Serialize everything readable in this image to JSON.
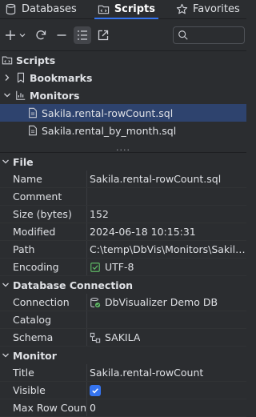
{
  "tabs": [
    {
      "label": "Databases",
      "icon": "database-icon"
    },
    {
      "label": "Scripts",
      "icon": "scripts-folder-icon"
    },
    {
      "label": "Favorites",
      "icon": "star-icon"
    }
  ],
  "search": {
    "placeholder": ""
  },
  "tree": {
    "scripts": "Scripts",
    "bookmarks": "Bookmarks",
    "monitors": "Monitors",
    "files": [
      "Sakila.rental-rowCount.sql",
      "Sakila.rental_by_month.sql"
    ]
  },
  "splitter": "....",
  "sections": {
    "file": "File",
    "db": "Database Connection",
    "monitor": "Monitor"
  },
  "file_props": {
    "name_label": "Name",
    "name": "Sakila.rental-rowCount.sql",
    "comment_label": "Comment",
    "comment": "",
    "size_label": "Size (bytes)",
    "size": "152",
    "modified_label": "Modified",
    "modified": "2024-06-18 10:15:31",
    "path_label": "Path",
    "path": "C:\\temp\\DbVis\\Monitors\\Sakila.rental-rowCount.sql",
    "encoding_label": "Encoding",
    "encoding": "UTF-8"
  },
  "db_props": {
    "connection_label": "Connection",
    "connection": "DbVisualizer Demo DB",
    "catalog_label": "Catalog",
    "catalog": "",
    "schema_label": "Schema",
    "schema": "SAKILA"
  },
  "monitor_props": {
    "title_label": "Title",
    "title": "Sakila.rental-rowCount",
    "visible_label": "Visible",
    "visible": true,
    "maxrow_label": "Max Row Count",
    "maxrow": "0"
  },
  "colors": {
    "accent": "#3574f0",
    "selection": "#2e436e",
    "background": "#2b2d30"
  }
}
